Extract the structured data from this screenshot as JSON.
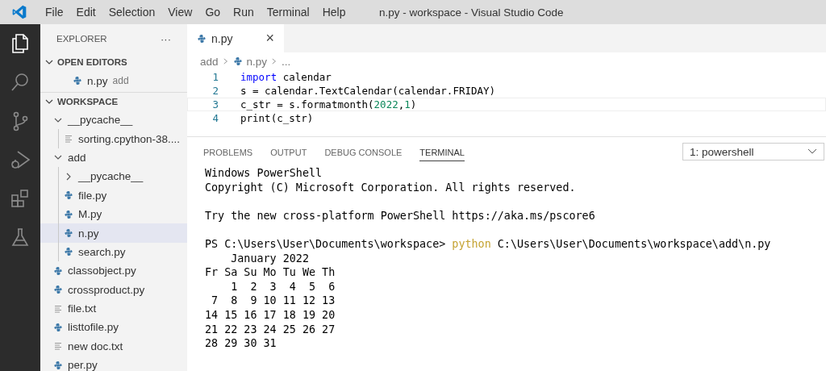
{
  "menu": [
    "File",
    "Edit",
    "Selection",
    "View",
    "Go",
    "Run",
    "Terminal",
    "Help"
  ],
  "window": {
    "title": "n.py - workspace - Visual Studio Code"
  },
  "activity_bar": [
    {
      "kind": "files",
      "selected": true
    },
    {
      "kind": "search",
      "selected": false
    },
    {
      "kind": "source-control",
      "selected": false
    },
    {
      "kind": "run",
      "selected": false
    },
    {
      "kind": "extensions",
      "selected": false
    },
    {
      "kind": "testing",
      "selected": false
    }
  ],
  "sidebar": {
    "title": "EXPLORER",
    "more": "···",
    "open_editors": {
      "title": "OPEN EDITORS",
      "expanded": true,
      "items": [
        {
          "name": "n.py",
          "folder": "add",
          "kind": "python"
        }
      ]
    },
    "workspace": {
      "title": "WORKSPACE",
      "expanded": true,
      "items": [
        {
          "name": "__pycache__",
          "kind": "folder",
          "expanded": true,
          "selected": false,
          "children": [
            {
              "name": "sorting.cpython-38....",
              "kind": "text",
              "selected": false
            }
          ]
        },
        {
          "name": "add",
          "kind": "folder",
          "expanded": true,
          "selected": false,
          "children": [
            {
              "name": "__pycache__",
              "kind": "folder",
              "expanded": false,
              "selected": false
            },
            {
              "name": "file.py",
              "kind": "python",
              "selected": false
            },
            {
              "name": "M.py",
              "kind": "python",
              "selected": false
            },
            {
              "name": "n.py",
              "kind": "python",
              "selected": true
            },
            {
              "name": "search.py",
              "kind": "python",
              "selected": false
            }
          ]
        },
        {
          "name": "classobject.py",
          "kind": "python",
          "selected": false
        },
        {
          "name": "crossproduct.py",
          "kind": "python",
          "selected": false
        },
        {
          "name": "file.txt",
          "kind": "text",
          "selected": false
        },
        {
          "name": "listtofile.py",
          "kind": "python",
          "selected": false
        },
        {
          "name": "new doc.txt",
          "kind": "text",
          "selected": false
        },
        {
          "name": "per.py",
          "kind": "python",
          "selected": false
        }
      ]
    }
  },
  "editor": {
    "tabs": [
      {
        "name": "n.py",
        "kind": "python",
        "selected": true,
        "close": "×"
      }
    ],
    "breadcrumb": [
      "add",
      "n.py",
      "..."
    ],
    "lines": [
      {
        "number": "1",
        "current": false,
        "tokens": [
          {
            "kind": "keyword",
            "text": "import"
          },
          {
            "kind": "plain",
            "text": " calendar"
          }
        ]
      },
      {
        "number": "2",
        "current": false,
        "tokens": [
          {
            "kind": "plain",
            "text": "s = calendar.TextCalendar(calendar.FRIDAY)"
          }
        ]
      },
      {
        "number": "3",
        "current": true,
        "tokens": [
          {
            "kind": "plain",
            "text": "c_str = s.formatmonth("
          },
          {
            "kind": "number",
            "text": "2022"
          },
          {
            "kind": "plain",
            "text": ","
          },
          {
            "kind": "number",
            "text": "1"
          },
          {
            "kind": "plain",
            "text": ")"
          }
        ]
      },
      {
        "number": "4",
        "current": false,
        "tokens": [
          {
            "kind": "plain",
            "text": "print(c_str)"
          }
        ]
      }
    ]
  },
  "panel": {
    "tabs": [
      {
        "label": "PROBLEMS",
        "selected": false
      },
      {
        "label": "OUTPUT",
        "selected": false
      },
      {
        "label": "DEBUG CONSOLE",
        "selected": false
      },
      {
        "label": "TERMINAL",
        "selected": true
      }
    ],
    "terminal_select": "1: powershell",
    "terminal": [
      [
        [
          {
            "kind": "plain",
            "text": "Windows PowerShell"
          }
        ],
        [
          {
            "kind": "plain",
            "text": "Copyright (C) Microsoft Corporation. All rights reserved."
          }
        ]
      ],
      [
        [
          {
            "kind": "plain",
            "text": "Try the new cross-platform PowerShell https://aka.ms/pscore6"
          }
        ]
      ],
      [
        [
          {
            "kind": "plain",
            "text": "PS C:\\Users\\User\\Documents\\workspace> "
          },
          {
            "kind": "command",
            "text": "python"
          },
          {
            "kind": "plain",
            "text": " C:\\Users\\User\\Documents\\workspace\\add\\n.py"
          }
        ],
        [
          {
            "kind": "plain",
            "text": "    January 2022"
          }
        ],
        [
          {
            "kind": "plain",
            "text": "Fr Sa Su Mo Tu We Th"
          }
        ],
        [
          {
            "kind": "plain",
            "text": "    1  2  3  4  5  6"
          }
        ],
        [
          {
            "kind": "plain",
            "text": " 7  8  9 10 11 12 13"
          }
        ],
        [
          {
            "kind": "plain",
            "text": "14 15 16 17 18 19 20"
          }
        ],
        [
          {
            "kind": "plain",
            "text": "21 22 23 24 25 26 27"
          }
        ],
        [
          {
            "kind": "plain",
            "text": "28 29 30 31"
          }
        ]
      ]
    ]
  }
}
